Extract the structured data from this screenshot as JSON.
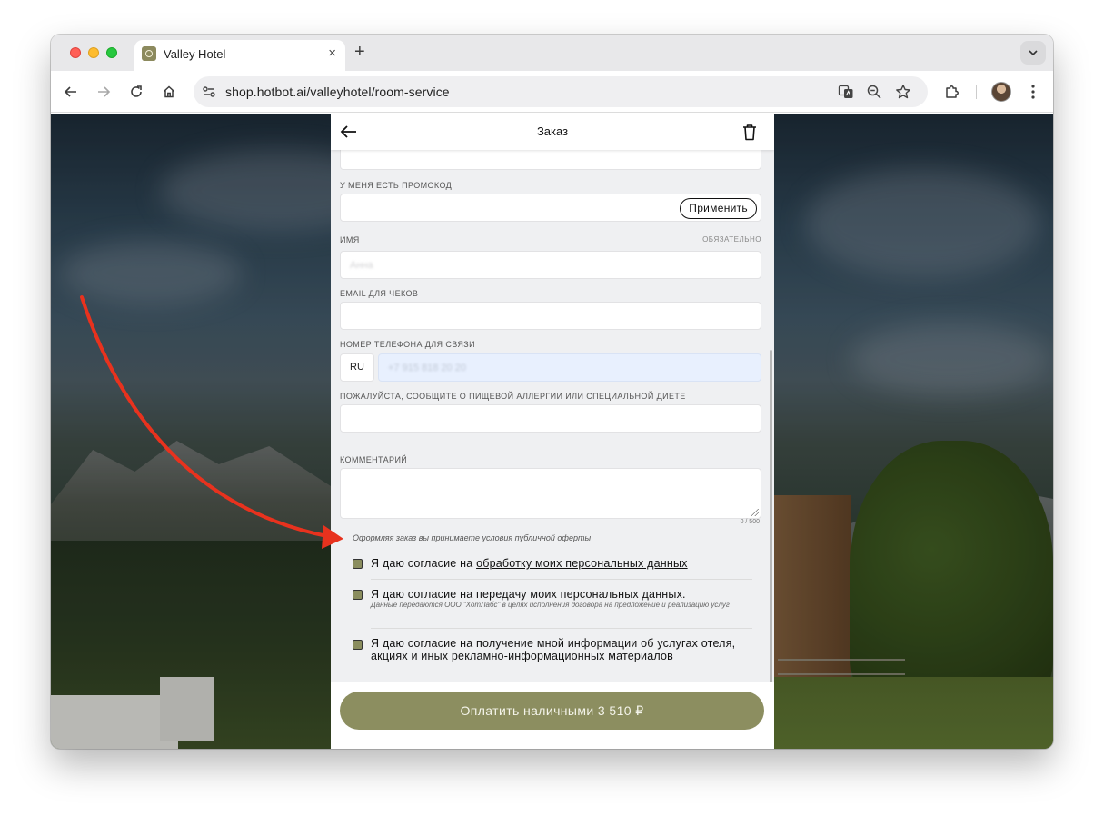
{
  "browser": {
    "tab_title": "Valley Hotel",
    "new_tab": "+",
    "tab_close": "×",
    "url": "shop.hotbot.ai/valleyhotel/room-service"
  },
  "header": {
    "title": "Заказ"
  },
  "promo": {
    "label": "У МЕНЯ ЕСТЬ ПРОМОКОД",
    "apply_label": "Применить"
  },
  "name": {
    "label": "ИМЯ",
    "required": "ОБЯЗАТЕЛЬНО",
    "placeholder": "Анна"
  },
  "email": {
    "label": "EMAIL ДЛЯ ЧЕКОВ"
  },
  "phone": {
    "label": "НОМЕР ТЕЛЕФОНА ДЛЯ СВЯЗИ",
    "country": "RU",
    "placeholder": "+7 915 818 20 20"
  },
  "allergy": {
    "label": "ПОЖАЛУЙСТА, СООБЩИТЕ О ПИЩЕВОЙ АЛЛЕРГИИ ИЛИ СПЕЦИАЛЬНОЙ ДИЕТЕ"
  },
  "comment": {
    "label": "КОММЕНТАРИЙ",
    "counter": "0 / 500"
  },
  "offer": {
    "text": "Оформляя заказ вы принимаете условия",
    "link": "публичной оферты"
  },
  "consents": [
    {
      "text": "Я даю согласие на",
      "link": "обработку моих персональных данных",
      "checked": true
    },
    {
      "text": "Я даю согласие на передачу моих персональных данных.",
      "sub": "Данные передаются ООО \"ХотЛабс\" в целях исполнения договора на предложение и реализацию услуг",
      "checked": true
    },
    {
      "text": "Я даю согласие на получение мной информации об услугах отеля, акциях и иных рекламно-информационных материалов",
      "checked": true
    }
  ],
  "pay": {
    "label": "Оплатить наличными 3 510 ₽"
  },
  "colors": {
    "accent": "#8c8e60",
    "annotation_arrow": "#e8321e"
  }
}
